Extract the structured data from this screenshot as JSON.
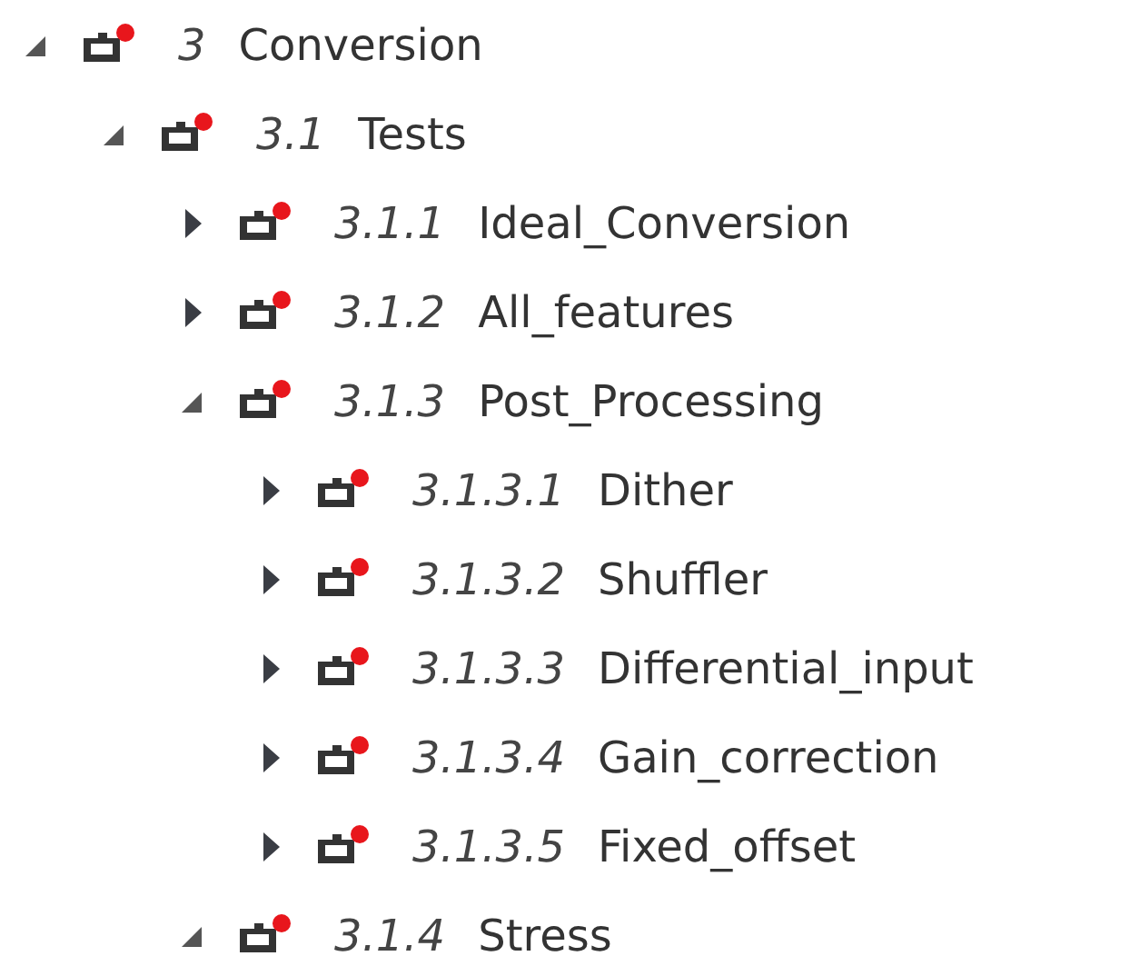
{
  "tree": [
    {
      "number": "3",
      "label": "Conversion",
      "expanded": true,
      "children": [
        {
          "number": "3.1",
          "label": "Tests",
          "expanded": true,
          "children": [
            {
              "number": "3.1.1",
              "label": "Ideal_Conversion",
              "expanded": false
            },
            {
              "number": "3.1.2",
              "label": "All_features",
              "expanded": false
            },
            {
              "number": "3.1.3",
              "label": "Post_Processing",
              "expanded": true,
              "children": [
                {
                  "number": "3.1.3.1",
                  "label": "Dither",
                  "expanded": false
                },
                {
                  "number": "3.1.3.2",
                  "label": "Shuffler",
                  "expanded": false
                },
                {
                  "number": "3.1.3.3",
                  "label": "Differential_input",
                  "expanded": false
                },
                {
                  "number": "3.1.3.4",
                  "label": "Gain_correction",
                  "expanded": false
                },
                {
                  "number": "3.1.3.5",
                  "label": "Fixed_offset",
                  "expanded": false
                }
              ]
            },
            {
              "number": "3.1.4",
              "label": "Stress",
              "expanded": true
            }
          ]
        }
      ]
    }
  ]
}
